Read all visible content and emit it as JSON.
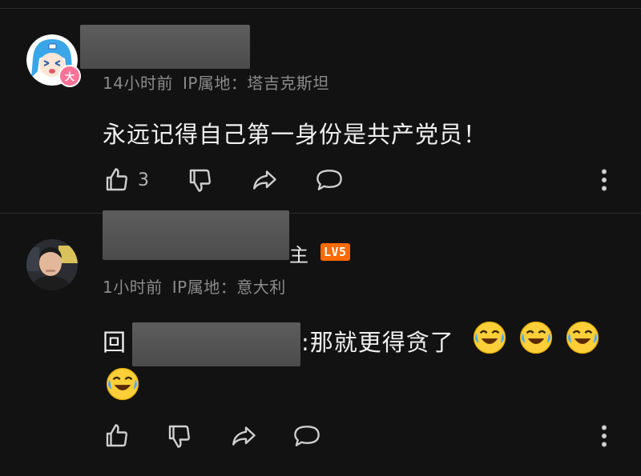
{
  "comments": [
    {
      "avatar": {
        "icon": "anime-girl-avatar-icon",
        "badge_text": "大"
      },
      "username": "",
      "time": "14小时前",
      "ip_location": "IP属地：塔吉克斯坦",
      "content": "永远记得自己第一身份是共产党员！",
      "likes": "3"
    },
    {
      "avatar": {
        "icon": "man-photo-avatar-icon"
      },
      "username_suffix": "主",
      "level": "LV5",
      "time": "1小时前",
      "ip_location": "IP属地：意大利",
      "reply_prefix": "回",
      "reply_text": ":那就更得贪了",
      "emojis": [
        "laughing-crying-emoji",
        "laughing-crying-emoji",
        "laughing-crying-emoji",
        "laughing-crying-emoji"
      ]
    }
  ],
  "colors": {
    "background": "#121212",
    "badge_pink": "#fb7299",
    "level_orange": "#ff6a00",
    "meta_gray": "#8b8b8b"
  }
}
